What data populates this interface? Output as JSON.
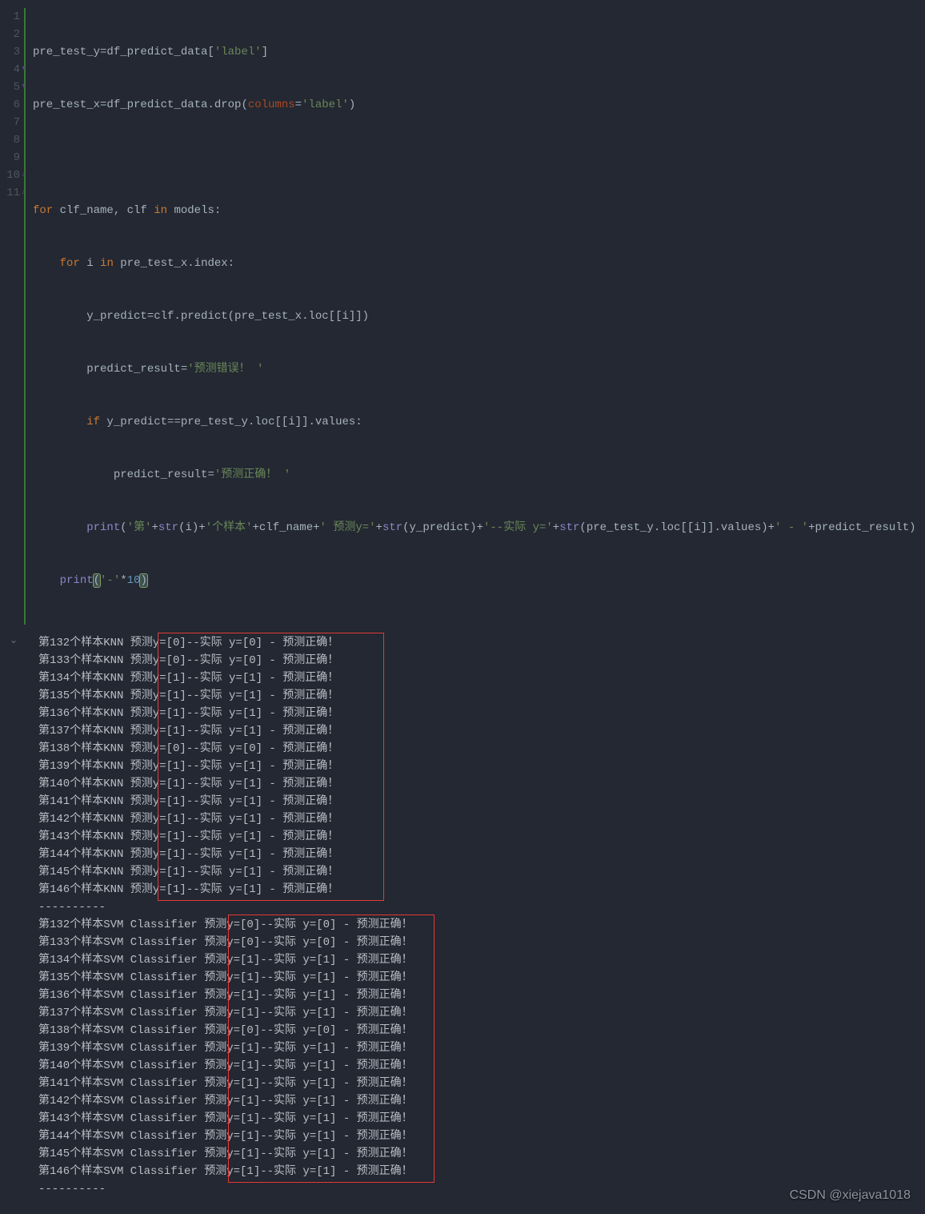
{
  "colors": {
    "bg": "#232832",
    "keyword": "#cc7832",
    "string": "#6a8759",
    "number": "#6897bb",
    "builtin": "#8888c6",
    "identifier": "#a7b2bd",
    "boxBorder": "#e53935"
  },
  "gutter": [
    "1",
    "2",
    "3",
    "4",
    "5",
    "6",
    "7",
    "8",
    "9",
    "10",
    "11"
  ],
  "code": {
    "l1": {
      "a": "pre_test_y=df_predict_data[",
      "b": "'label'",
      "c": "]"
    },
    "l2": {
      "a": "pre_test_x=df_predict_data.drop(",
      "b": "columns",
      "c": "=",
      "d": "'label'",
      "e": ")"
    },
    "l3": "",
    "l4": {
      "a": "for",
      "b": " clf_name, clf ",
      "c": "in",
      "d": " models:"
    },
    "l5": {
      "a": "for",
      "b": " i ",
      "c": "in",
      "d": " pre_test_x.index:"
    },
    "l6": {
      "a": "y_predict=clf.predict(pre_test_x.loc[[i]])"
    },
    "l7": {
      "a": "predict_result=",
      "b": "'预测错误！ '"
    },
    "l8": {
      "a": "if",
      "b": " y_predict==pre_test_y.loc[[i]].values:"
    },
    "l9": {
      "a": "predict_result=",
      "b": "'预测正确！ '"
    },
    "l10": {
      "a": "print",
      "b": "(",
      "c": "'第'",
      "d": "+",
      "e": "str",
      "f": "(i)+",
      "g": "'个样本'",
      "h": "+clf_name+",
      "i": "' 预测y='",
      "j": "+",
      "k": "str",
      "l": "(y_predict)+",
      "m": "'--实际 y='",
      "n": "+",
      "o": "str",
      "p": "(pre_test_y.loc[[i]].values)+",
      "q": "' - '",
      "r": "+predict_result)"
    },
    "l11": {
      "a": "print",
      "b": "(",
      "c": "'-'",
      "d": "*",
      "e": "10",
      "f": ")"
    }
  },
  "output": {
    "section1_prefix_model": "KNN",
    "section2_prefix_model": "SVM Classifier",
    "separator": "----------",
    "rows1": [
      {
        "idx": "132",
        "py": "[0]",
        "ay": "[0]",
        "res": "预测正确！"
      },
      {
        "idx": "133",
        "py": "[0]",
        "ay": "[0]",
        "res": "预测正确！"
      },
      {
        "idx": "134",
        "py": "[1]",
        "ay": "[1]",
        "res": "预测正确！"
      },
      {
        "idx": "135",
        "py": "[1]",
        "ay": "[1]",
        "res": "预测正确！"
      },
      {
        "idx": "136",
        "py": "[1]",
        "ay": "[1]",
        "res": "预测正确！"
      },
      {
        "idx": "137",
        "py": "[1]",
        "ay": "[1]",
        "res": "预测正确！"
      },
      {
        "idx": "138",
        "py": "[0]",
        "ay": "[0]",
        "res": "预测正确！"
      },
      {
        "idx": "139",
        "py": "[1]",
        "ay": "[1]",
        "res": "预测正确！"
      },
      {
        "idx": "140",
        "py": "[1]",
        "ay": "[1]",
        "res": "预测正确！"
      },
      {
        "idx": "141",
        "py": "[1]",
        "ay": "[1]",
        "res": "预测正确！"
      },
      {
        "idx": "142",
        "py": "[1]",
        "ay": "[1]",
        "res": "预测正确！"
      },
      {
        "idx": "143",
        "py": "[1]",
        "ay": "[1]",
        "res": "预测正确！"
      },
      {
        "idx": "144",
        "py": "[1]",
        "ay": "[1]",
        "res": "预测正确！"
      },
      {
        "idx": "145",
        "py": "[1]",
        "ay": "[1]",
        "res": "预测正确！"
      },
      {
        "idx": "146",
        "py": "[1]",
        "ay": "[1]",
        "res": "预测正确！"
      }
    ],
    "rows2": [
      {
        "idx": "132",
        "py": "[0]",
        "ay": "[0]",
        "res": "预测正确！"
      },
      {
        "idx": "133",
        "py": "[0]",
        "ay": "[0]",
        "res": "预测正确！"
      },
      {
        "idx": "134",
        "py": "[1]",
        "ay": "[1]",
        "res": "预测正确！"
      },
      {
        "idx": "135",
        "py": "[1]",
        "ay": "[1]",
        "res": "预测正确！"
      },
      {
        "idx": "136",
        "py": "[1]",
        "ay": "[1]",
        "res": "预测正确！"
      },
      {
        "idx": "137",
        "py": "[1]",
        "ay": "[1]",
        "res": "预测正确！"
      },
      {
        "idx": "138",
        "py": "[0]",
        "ay": "[0]",
        "res": "预测正确！"
      },
      {
        "idx": "139",
        "py": "[1]",
        "ay": "[1]",
        "res": "预测正确！"
      },
      {
        "idx": "140",
        "py": "[1]",
        "ay": "[1]",
        "res": "预测正确！"
      },
      {
        "idx": "141",
        "py": "[1]",
        "ay": "[1]",
        "res": "预测正确！"
      },
      {
        "idx": "142",
        "py": "[1]",
        "ay": "[1]",
        "res": "预测正确！"
      },
      {
        "idx": "143",
        "py": "[1]",
        "ay": "[1]",
        "res": "预测正确！"
      },
      {
        "idx": "144",
        "py": "[1]",
        "ay": "[1]",
        "res": "预测正确！"
      },
      {
        "idx": "145",
        "py": "[1]",
        "ay": "[1]",
        "res": "预测正确！"
      },
      {
        "idx": "146",
        "py": "[1]",
        "ay": "[1]",
        "res": "预测正确！"
      }
    ]
  },
  "labels": {
    "prefix_first": "第",
    "prefix_sample": "个样本",
    "pred_label": " 预测y=",
    "actual_label": "--实际 y=",
    "dash": " - "
  },
  "watermark": "CSDN @xiejava1018"
}
